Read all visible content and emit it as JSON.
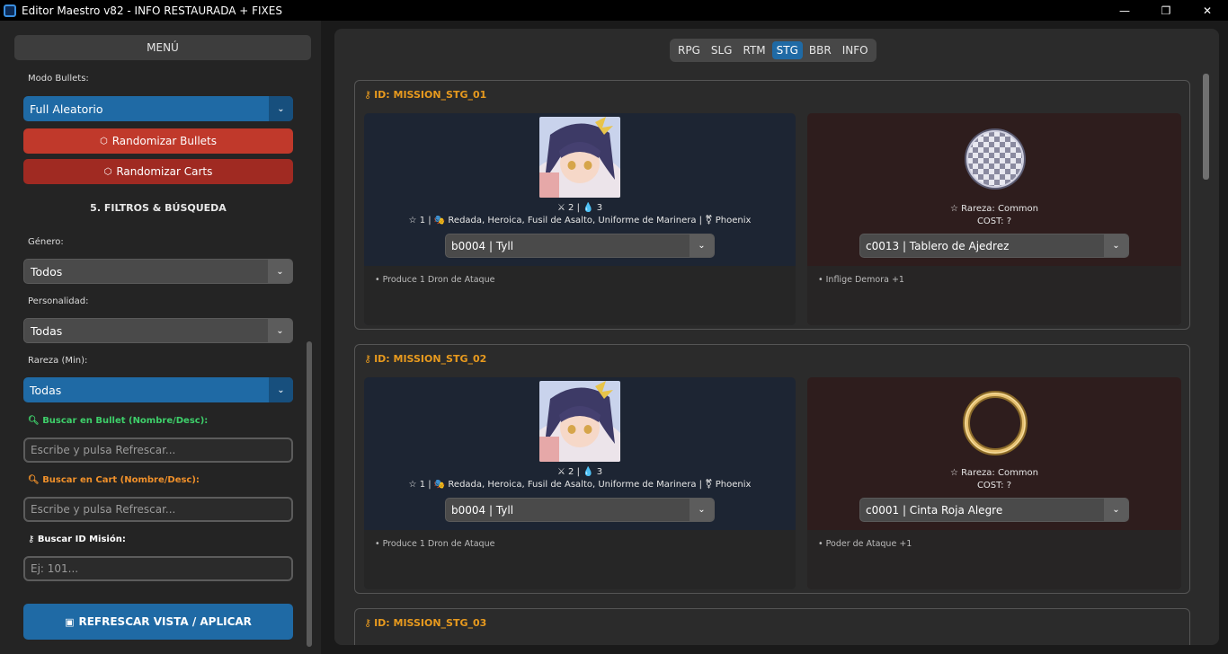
{
  "window": {
    "title": "Editor Maestro v82 - INFO RESTAURADA + FIXES",
    "minimize": "—",
    "maximize": "❐",
    "close": "✕"
  },
  "sidebar": {
    "menu_title": "MENÚ",
    "modo_bullets_label": "Modo Bullets:",
    "modo_bullets_value": "Full Aleatorio",
    "randomize_bullets": "Randomizar Bullets",
    "randomize_carts": "Randomizar Carts",
    "filters_title": "5. FILTROS & BÚSQUEDA",
    "genero_label": "Género:",
    "genero_value": "Todos",
    "personalidad_label": "Personalidad:",
    "personalidad_value": "Todas",
    "rareza_label": "Rareza (Min):",
    "rareza_value": "Todas",
    "search_bullet_label": "Buscar en Bullet (Nombre/Desc):",
    "search_bullet_placeholder": "Escribe y pulsa Refrescar...",
    "search_cart_label": "Buscar en Cart (Nombre/Desc):",
    "search_cart_placeholder": "Escribe y pulsa Refrescar...",
    "search_id_label": "Buscar ID Misión:",
    "search_id_placeholder": "Ej: 101...",
    "refresh_button": "REFRESCAR VISTA / APLICAR"
  },
  "tabs": [
    {
      "label": "RPG",
      "active": false
    },
    {
      "label": "SLG",
      "active": false
    },
    {
      "label": "RTM",
      "active": false
    },
    {
      "label": "STG",
      "active": true
    },
    {
      "label": "BBR",
      "active": false
    },
    {
      "label": "INFO",
      "active": false
    }
  ],
  "missions": [
    {
      "id": "ID: MISSION_STG_01",
      "bullet_stats1": "2 | 💧 3",
      "bullet_stats2": "1 | 🎭 Redada, Heroica, Fusil de Asalto, Uniforme de Marinera | ⚧ Phoenix",
      "bullet_select": "b0004 | Tyll",
      "bullet_desc": "• Produce 1 Dron de Ataque",
      "cart_rarity": "Rareza: Common",
      "cart_cost": "COST: ?",
      "cart_select": "c0013 | Tablero de Ajedrez",
      "cart_desc": "• Inflige Demora +1"
    },
    {
      "id": "ID: MISSION_STG_02",
      "bullet_stats1": "2 | 💧 3",
      "bullet_stats2": "1 | 🎭 Redada, Heroica, Fusil de Asalto, Uniforme de Marinera | ⚧ Phoenix",
      "bullet_select": "b0004 | Tyll",
      "bullet_desc": "• Produce 1 Dron de Ataque",
      "cart_rarity": "Rareza: Common",
      "cart_cost": "COST: ?",
      "cart_select": "c0001 | Cinta Roja Alegre",
      "cart_desc": "• Poder de Ataque +1"
    },
    {
      "id": "ID: MISSION_STG_03"
    }
  ]
}
